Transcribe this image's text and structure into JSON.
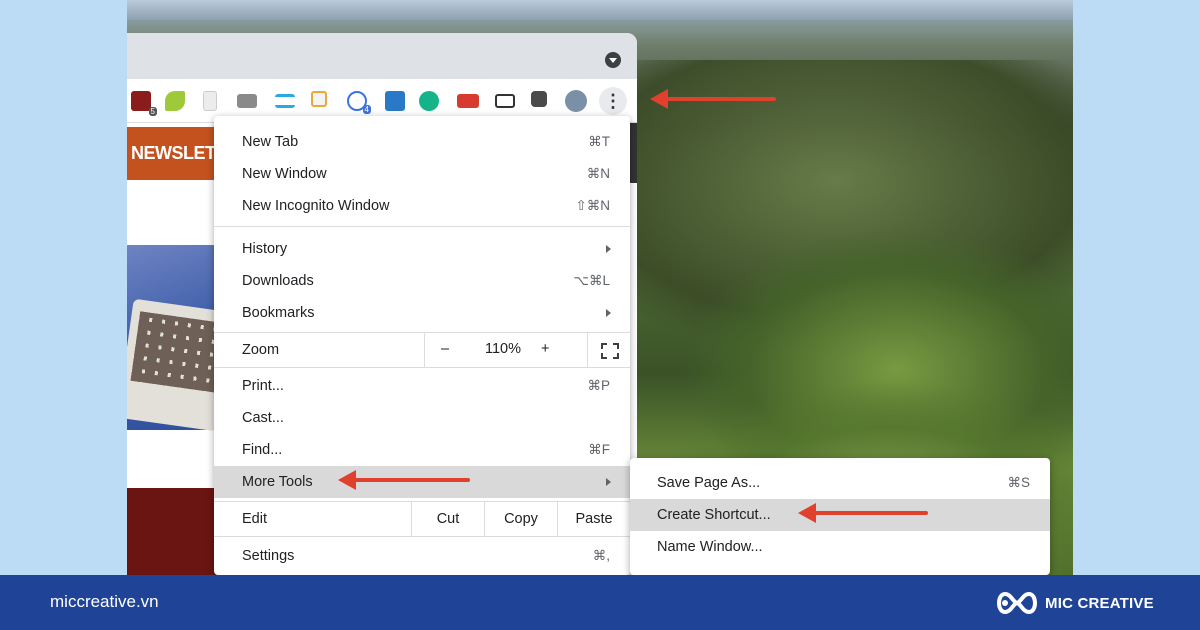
{
  "menu": {
    "new_tab": {
      "label": "New Tab",
      "shortcut": "⌘T"
    },
    "new_window": {
      "label": "New Window",
      "shortcut": "⌘N"
    },
    "new_incognito": {
      "label": "New Incognito Window",
      "shortcut": "⇧⌘N"
    },
    "history": {
      "label": "History"
    },
    "downloads": {
      "label": "Downloads",
      "shortcut": "⌥⌘L"
    },
    "bookmarks": {
      "label": "Bookmarks"
    },
    "zoom": {
      "label": "Zoom",
      "minus": "–",
      "value": "110%",
      "plus": "+"
    },
    "print": {
      "label": "Print...",
      "shortcut": "⌘P"
    },
    "cast": {
      "label": "Cast..."
    },
    "find": {
      "label": "Find...",
      "shortcut": "⌘F"
    },
    "more_tools": {
      "label": "More Tools"
    },
    "edit": {
      "label": "Edit",
      "cut": "Cut",
      "copy": "Copy",
      "paste": "Paste"
    },
    "settings": {
      "label": "Settings",
      "shortcut": "⌘,"
    }
  },
  "submenu": {
    "save_page": {
      "label": "Save Page As...",
      "shortcut": "⌘S"
    },
    "create_shortcut": {
      "label": "Create Shortcut..."
    },
    "name_window": {
      "label": "Name Window..."
    }
  },
  "page": {
    "banner_text": "NEWSLETTER"
  },
  "extensions": {
    "ublock_badge": "5",
    "todo_badge": "4"
  },
  "footer": {
    "site": "miccreative.vn",
    "brand": "MIC CREATIVE"
  },
  "colors": {
    "footer_bg": "#1f4396",
    "arrow": "#e0402e",
    "highlight": "#d9d9d9"
  }
}
